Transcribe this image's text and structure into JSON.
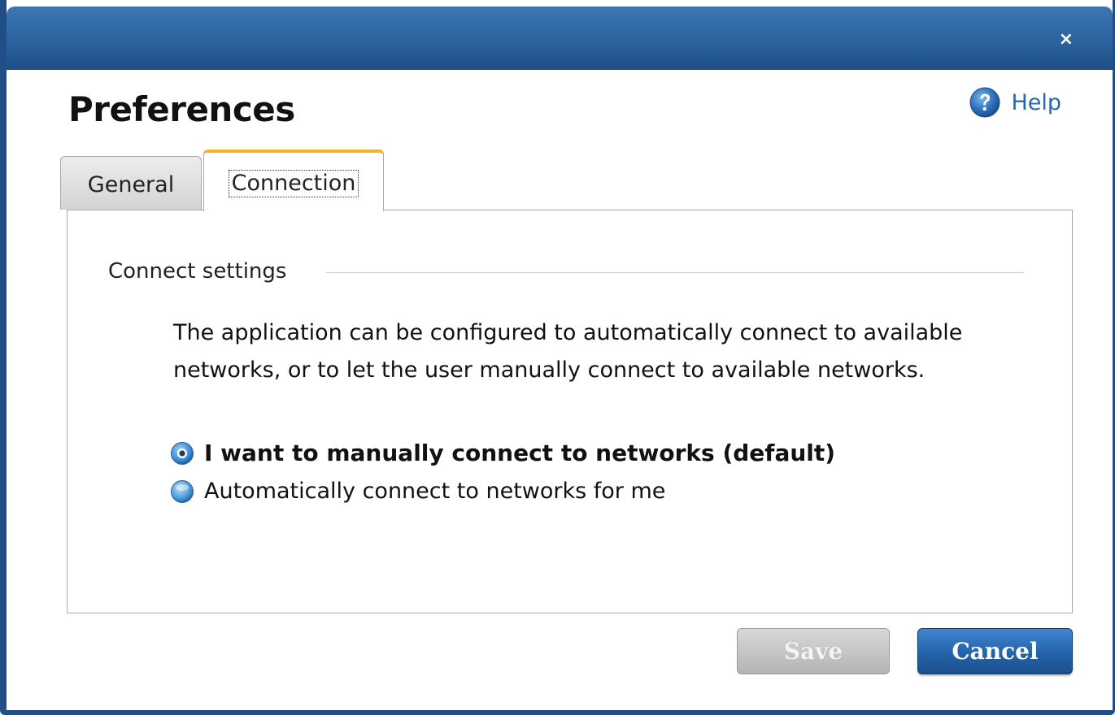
{
  "window": {
    "close_glyph": "×"
  },
  "header": {
    "title": "Preferences",
    "help_label": "Help",
    "help_icon": "question-mark-icon"
  },
  "tabs": [
    {
      "label": "General",
      "selected": false
    },
    {
      "label": "Connection",
      "selected": true
    }
  ],
  "connect_settings": {
    "group_label": "Connect settings",
    "description": "The application can be configured to automatically connect to available networks, or to let the user manually connect to available networks.",
    "options": [
      {
        "label": "I want to manually connect to networks (default)",
        "selected": true
      },
      {
        "label": "Automatically connect to networks for me",
        "selected": false
      }
    ]
  },
  "buttons": {
    "save_label": "Save",
    "save_enabled": false,
    "cancel_label": "Cancel"
  },
  "colors": {
    "titlebar": "#2f67a3",
    "selected_tab_accent": "#f2b428",
    "primary_button": "#2566ad",
    "link": "#2a67b2"
  }
}
